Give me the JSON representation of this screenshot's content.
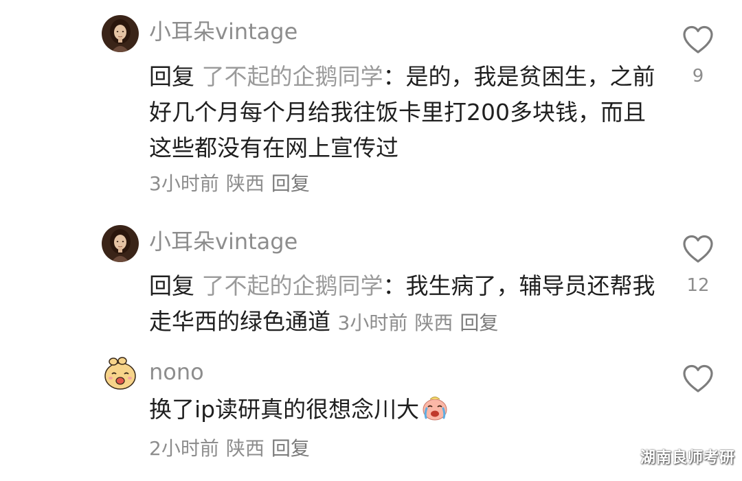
{
  "comments": [
    {
      "username": "小耳朵vintage",
      "reply_prefix": "回复",
      "reply_target": "了不起的企鹅同学",
      "text": "：是的，我是贫困生，之前好几个月每个月给我往饭卡里打200多块钱，而且这些都没有在网上宣传过",
      "time": "3小时前",
      "location": "陕西",
      "reply_label": "回复",
      "likes": "9",
      "avatar_icon": "portrait-avatar-icon"
    },
    {
      "username": "小耳朵vintage",
      "reply_prefix": "回复",
      "reply_target": "了不起的企鹅同学",
      "text": "：我生病了，辅导员还帮我走华西的绿色通道",
      "time": "3小时前",
      "location": "陕西",
      "reply_label": "回复",
      "likes": "12",
      "avatar_icon": "portrait-avatar-icon"
    },
    {
      "username": "nono",
      "text": "换了ip读研真的很想念川大",
      "emoji": "crying-face-emoji",
      "time": "2小时前",
      "location": "陕西",
      "reply_label": "回复",
      "likes": "",
      "avatar_icon": "cartoon-avatar-icon"
    }
  ],
  "watermark": "湖南良师考研",
  "colors": {
    "text": "#1f1f1f",
    "muted": "#8d8d8d",
    "background": "#ffffff"
  }
}
